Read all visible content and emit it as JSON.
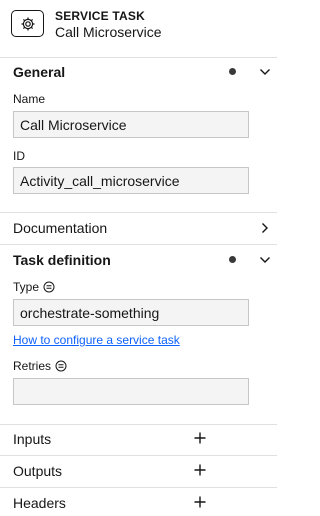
{
  "header": {
    "type_label": "SERVICE TASK",
    "name": "Call Microservice",
    "icon": "gear-icon"
  },
  "general": {
    "title": "General",
    "name_label": "Name",
    "name_value": "Call Microservice",
    "id_label": "ID",
    "id_value": "Activity_call_microservice"
  },
  "documentation": {
    "title": "Documentation"
  },
  "task_definition": {
    "title": "Task definition",
    "type_label": "Type",
    "type_value": "orchestrate-something",
    "help_link": "How to configure a service task",
    "retries_label": "Retries",
    "retries_value": ""
  },
  "inputs": {
    "title": "Inputs"
  },
  "outputs": {
    "title": "Outputs"
  },
  "headers": {
    "title": "Headers"
  },
  "colors": {
    "link": "#0f62fe",
    "border": "#e0e0e0",
    "field_bg": "#f4f4f4"
  }
}
